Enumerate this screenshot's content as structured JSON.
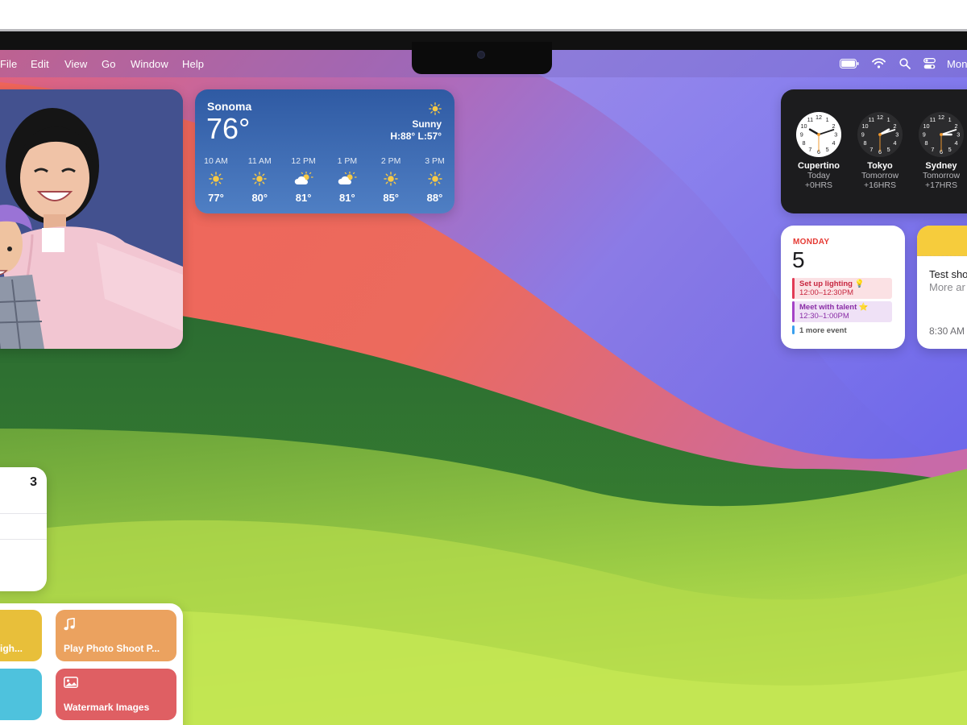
{
  "menu": {
    "items": [
      "File",
      "Edit",
      "View",
      "Go",
      "Window",
      "Help"
    ],
    "clock_text": "Mon"
  },
  "weather": {
    "city": "Sonoma",
    "temp": "76°",
    "condition": "Sunny",
    "hilo": "H:88° L:57°",
    "hours": [
      {
        "time": "10 AM",
        "icon": "sun-icon",
        "temp": "77°"
      },
      {
        "time": "11 AM",
        "icon": "sun-icon",
        "temp": "80°"
      },
      {
        "time": "12 PM",
        "icon": "partly-cloudy-icon",
        "temp": "81°"
      },
      {
        "time": "1 PM",
        "icon": "partly-cloudy-icon",
        "temp": "81°"
      },
      {
        "time": "2 PM",
        "icon": "sun-icon",
        "temp": "85°"
      },
      {
        "time": "3 PM",
        "icon": "sun-icon",
        "temp": "88°"
      }
    ]
  },
  "clocks": [
    {
      "city": "Cupertino",
      "day": "Today",
      "offset": "+0HRS",
      "theme": "light"
    },
    {
      "city": "Tokyo",
      "day": "Tomorrow",
      "offset": "+16HRS",
      "theme": "dark"
    },
    {
      "city": "Sydney",
      "day": "Tomorrow",
      "offset": "+17HRS",
      "theme": "dark"
    }
  ],
  "calendar": {
    "weekday": "MONDAY",
    "date": "5",
    "events": [
      {
        "title": "Set up lighting 💡",
        "time": "12:00–12:30PM"
      },
      {
        "title": "Meet with talent ⭐",
        "time": "12:30–1:00PM"
      }
    ],
    "more": "1 more event"
  },
  "notes": {
    "title": "Test sho",
    "subtitle": "More ar",
    "time": "8:30 AM"
  },
  "reminders": {
    "count": "3"
  },
  "shortcuts": {
    "items": [
      {
        "label": "o Ligh...",
        "color": "#e8bf3a"
      },
      {
        "label": "Play Photo Shoot P...",
        "color": "#eba25f"
      },
      {
        "label": "",
        "color": "#4ec2dd"
      },
      {
        "label": "Watermark Images",
        "color": "#df5f63"
      }
    ]
  },
  "colors": {
    "accent_red": "#e53a33",
    "weather_top": "#2f5aa3",
    "notes_yellow": "#f6cc3c"
  }
}
